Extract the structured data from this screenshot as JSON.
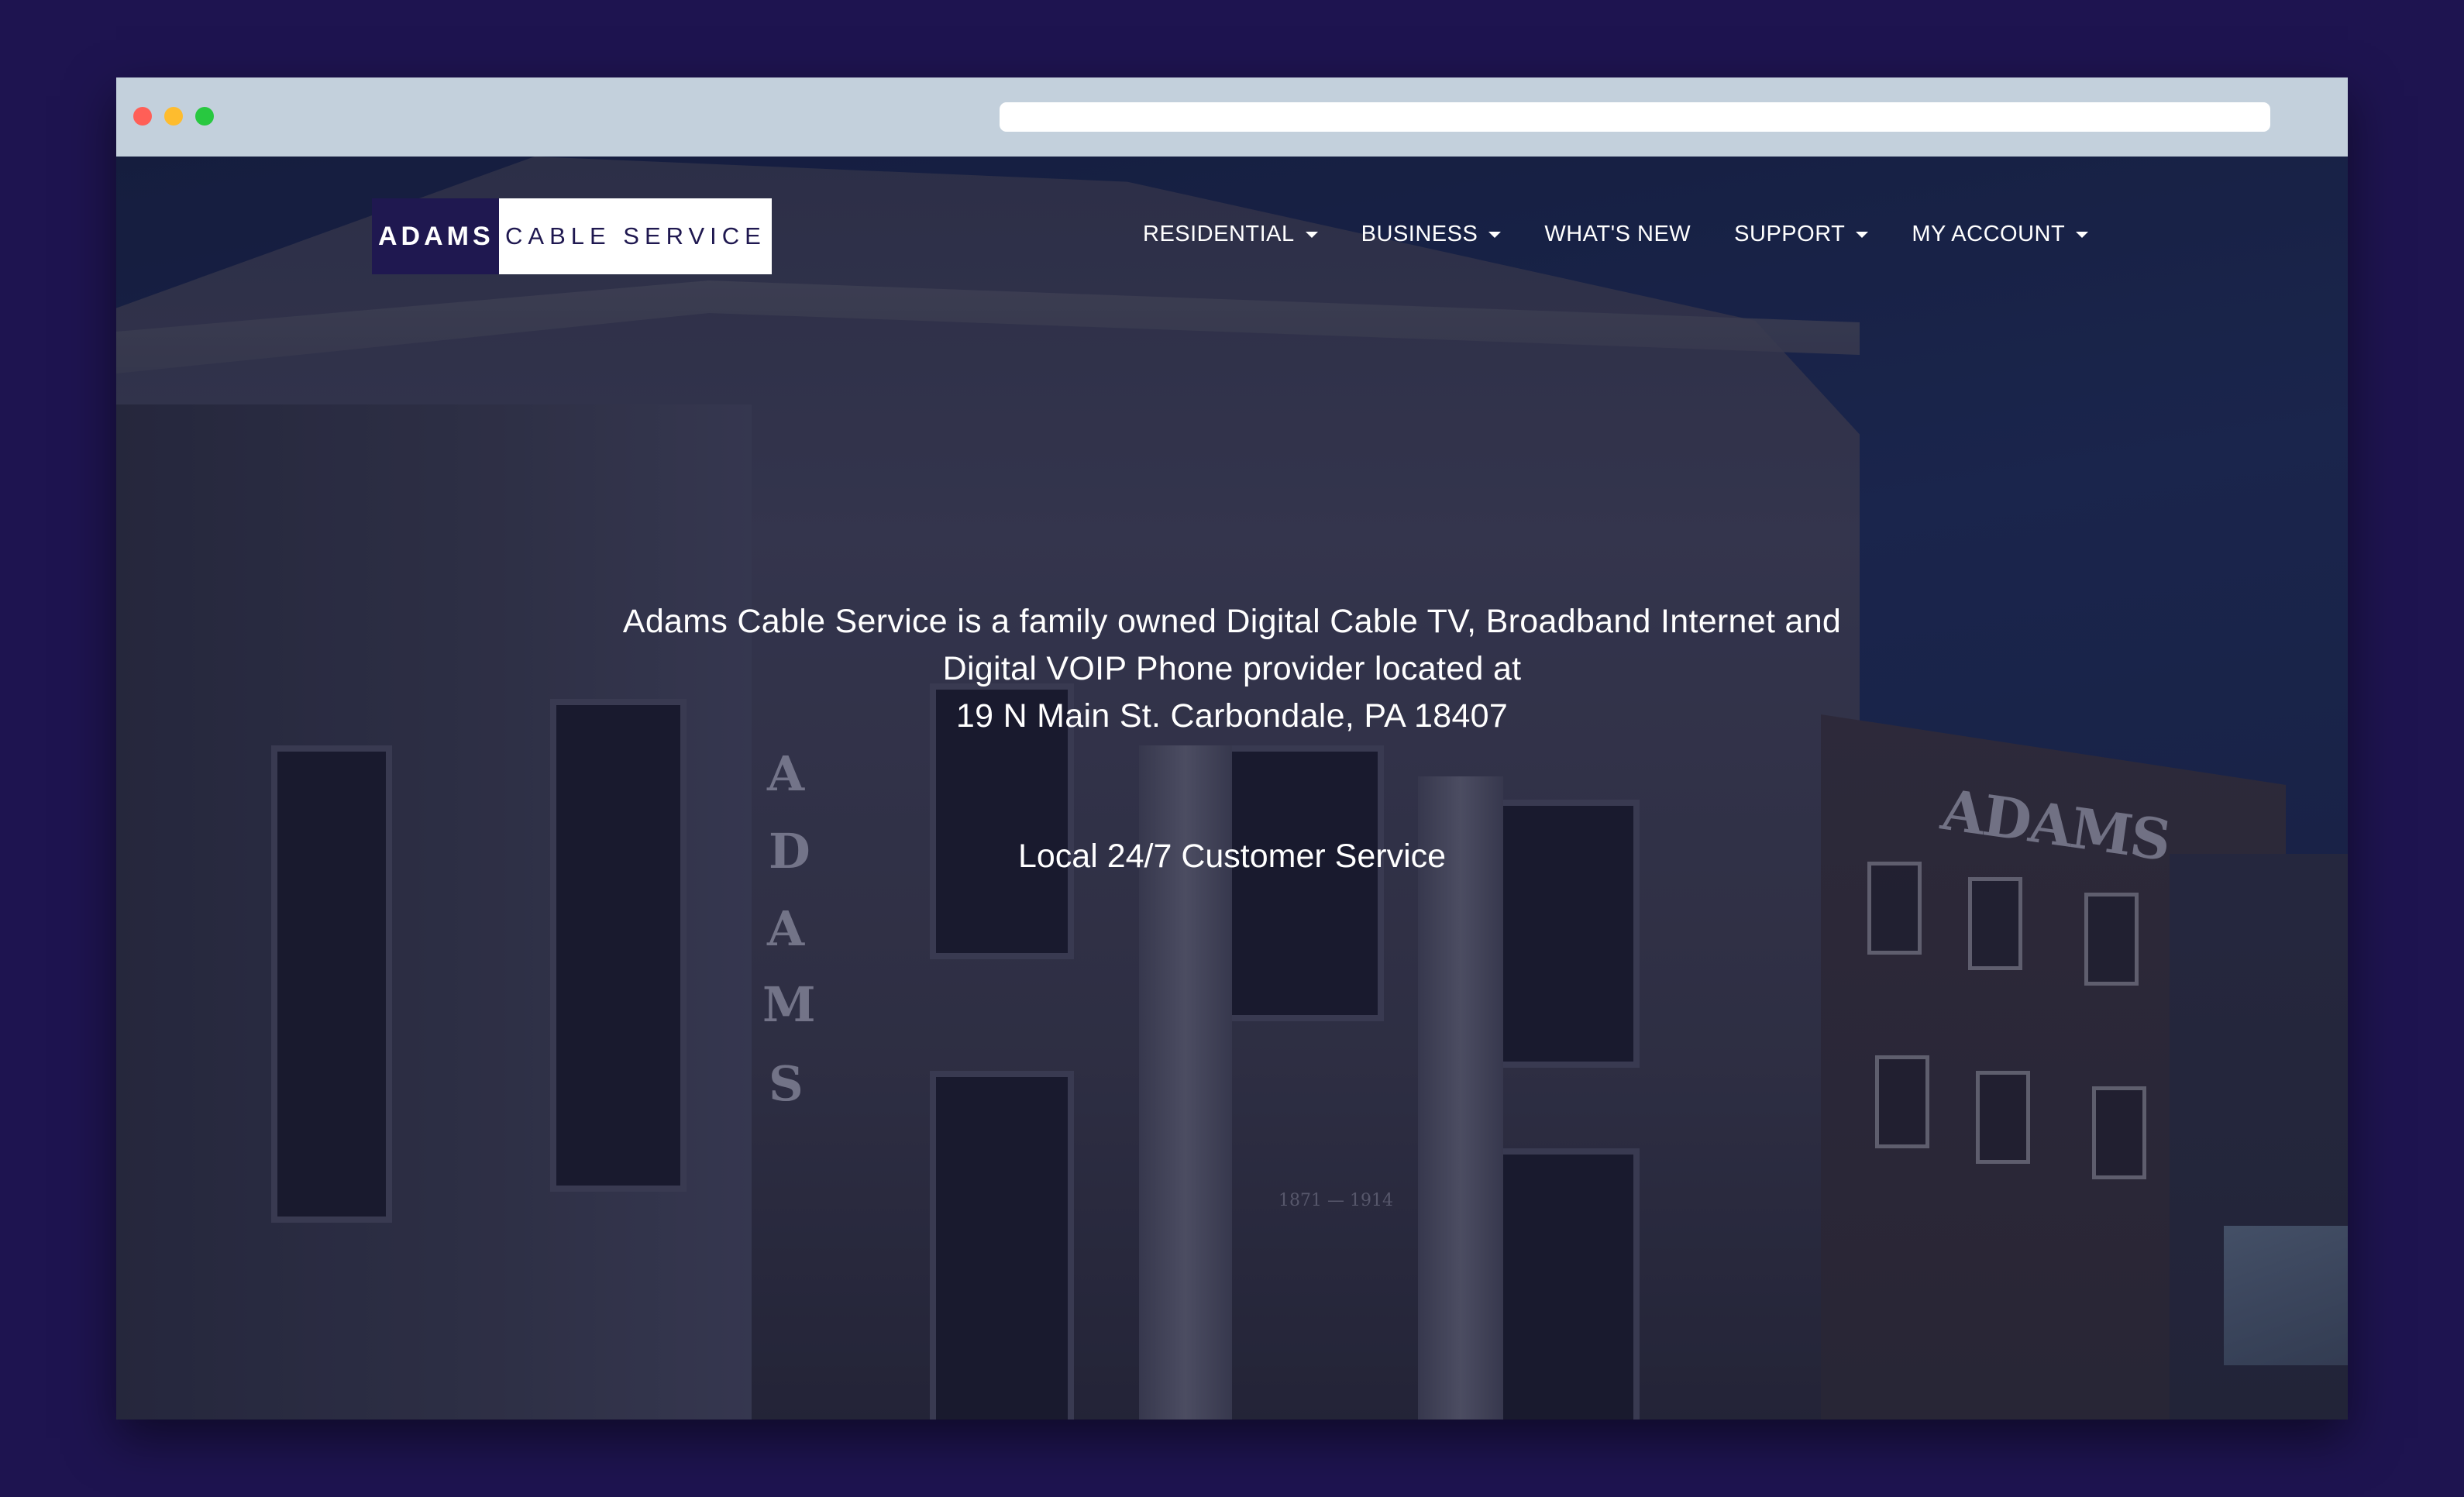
{
  "browser": {
    "window_controls": [
      "close",
      "minimize",
      "maximize"
    ],
    "url": ""
  },
  "logo": {
    "left_text": "ADAMS",
    "right_text": "CABLE SERVICE"
  },
  "nav": {
    "items": [
      {
        "label": "RESIDENTIAL",
        "has_dropdown": true
      },
      {
        "label": "BUSINESS",
        "has_dropdown": true
      },
      {
        "label": "WHAT'S NEW",
        "has_dropdown": false
      },
      {
        "label": "SUPPORT",
        "has_dropdown": true
      },
      {
        "label": "MY ACCOUNT",
        "has_dropdown": true
      }
    ]
  },
  "hero": {
    "line1": "Adams Cable Service is a family owned Digital Cable TV, Broadband Internet and",
    "line2": "Digital VOIP Phone provider located at",
    "line3": "19 N Main St. Carbondale, PA 18407",
    "service": "Local 24/7 Customer Service"
  },
  "background": {
    "building_letters": [
      "A",
      "D",
      "A",
      "M",
      "S"
    ],
    "building_sign": "ADAMS",
    "date_plaque": "1871 — 1914"
  },
  "colors": {
    "page_bg": "#1e1450",
    "chrome_bar": "#c3d0dc",
    "logo_dark": "#1f1850",
    "logo_light": "#ffffff",
    "nav_text": "#ffffff"
  }
}
